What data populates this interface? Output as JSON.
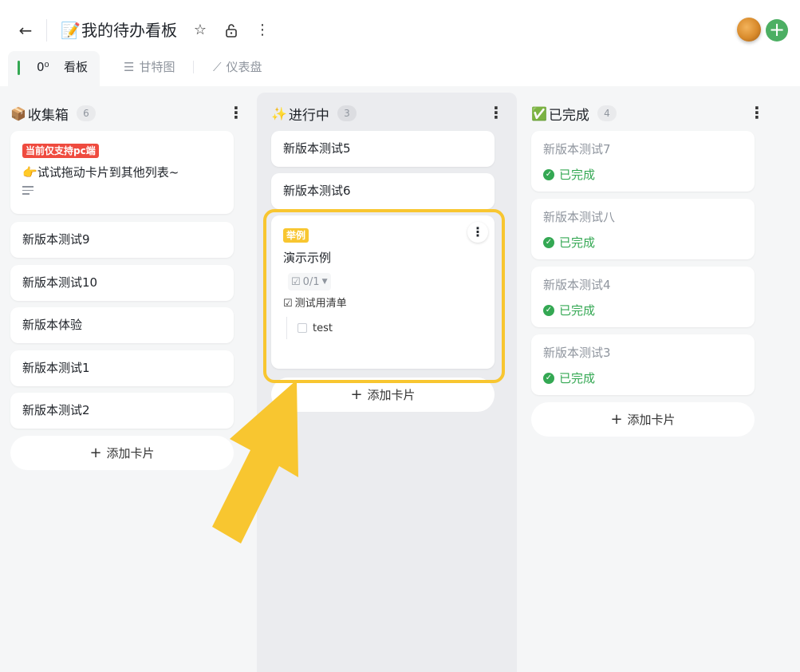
{
  "header": {
    "back_icon": "arrow-left-icon",
    "title_emoji": "📝",
    "title": "我的待办看板",
    "icons": [
      "star-icon",
      "lock-icon",
      "more-vertical-icon"
    ],
    "add_icon": "plus-icon"
  },
  "tabs": [
    {
      "label": "看板",
      "icon_text": "0⁰",
      "active": true
    },
    {
      "label": "甘特图",
      "icon_text": "☰",
      "active": false
    },
    {
      "label": "仪表盘",
      "icon_text": "⟋",
      "active": false
    }
  ],
  "columns": [
    {
      "emoji": "📦",
      "title": "收集箱",
      "count": "6",
      "cards": [
        {
          "tag": "当前仅支持pc端",
          "emoji": "👉",
          "text": "试试拖动卡片到其他列表~",
          "has_desc_icon": true
        },
        {
          "text": "新版本测试9"
        },
        {
          "text": "新版本测试10"
        },
        {
          "text": "新版本体验"
        },
        {
          "text": "新版本测试1"
        },
        {
          "text": "新版本测试2"
        }
      ],
      "add_label": "添加卡片"
    },
    {
      "emoji": "✨",
      "title": "进行中",
      "count": "3",
      "cards": [
        {
          "text": "新版本测试5"
        },
        {
          "text": "新版本测试6"
        },
        {
          "tag": "举例",
          "text": "演示示例",
          "checklist_progress": "0/1",
          "checklist_title": "测试用清单",
          "checklist_item": "test"
        }
      ],
      "add_label": "添加卡片"
    },
    {
      "emoji": "✅",
      "title": "已完成",
      "count": "4",
      "cards": [
        {
          "text": "新版本测试7",
          "status": "已完成"
        },
        {
          "text": "新版本测试八",
          "status": "已完成"
        },
        {
          "text": "新版本测试4",
          "status": "已完成"
        },
        {
          "text": "新版本测试3",
          "status": "已完成"
        }
      ],
      "add_label": "添加卡片"
    }
  ],
  "colors": {
    "accent_green": "#34a853",
    "tag_red": "#ef4b3f",
    "highlight_yellow": "#f8c630"
  }
}
